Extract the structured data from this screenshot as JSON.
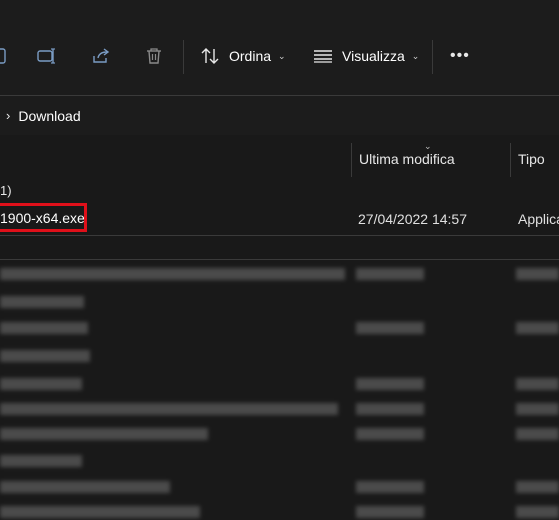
{
  "toolbar": {
    "buttons": [
      {
        "name": "rename-button",
        "icon": "rename-icon"
      },
      {
        "name": "share-button",
        "icon": "share-icon"
      },
      {
        "name": "delete-button",
        "icon": "trash-icon"
      }
    ],
    "sort_label": "Ordina",
    "view_label": "Visualizza",
    "more_label": "•••"
  },
  "address": {
    "separator": "›",
    "crumb": "Download"
  },
  "columns": {
    "modified": "Ultima modifica",
    "type": "Tipo"
  },
  "group": {
    "header_fragment": "1)"
  },
  "file": {
    "name": "1900-x64.exe",
    "modified": "27/04/2022 14:57",
    "type": "Applica"
  },
  "colors": {
    "background": "#191919",
    "highlight": "#e0101a"
  }
}
